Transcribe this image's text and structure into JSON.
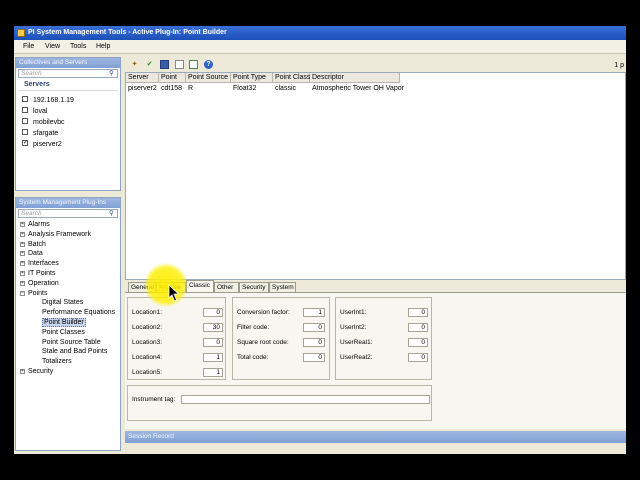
{
  "window": {
    "title": "PI System Management Tools - Active Plug-In: Point Builder"
  },
  "menu": [
    "File",
    "View",
    "Tools",
    "Help"
  ],
  "collectives": {
    "header": "Collectives and Servers",
    "search_placeholder": "Search",
    "servers_header": "Servers",
    "servers": [
      {
        "name": "192.168.1.19",
        "checked": false
      },
      {
        "name": "loval",
        "checked": false
      },
      {
        "name": "mobilevbc",
        "checked": false
      },
      {
        "name": "sfargate",
        "checked": false
      },
      {
        "name": "piserver2",
        "checked": true
      }
    ]
  },
  "plugins": {
    "header": "System Management Plug-Ins",
    "search_placeholder": "Search",
    "tree": [
      {
        "label": "Alarms",
        "type": "group"
      },
      {
        "label": "Analysis Framework",
        "type": "group"
      },
      {
        "label": "Batch",
        "type": "group"
      },
      {
        "label": "Data",
        "type": "group"
      },
      {
        "label": "Interfaces",
        "type": "group"
      },
      {
        "label": "IT Points",
        "type": "group"
      },
      {
        "label": "Operation",
        "type": "group"
      },
      {
        "label": "Points",
        "type": "open"
      },
      {
        "label": "Digital States",
        "type": "child"
      },
      {
        "label": "Performance Equations",
        "type": "child"
      },
      {
        "label": "Point Builder",
        "type": "child",
        "selected": true
      },
      {
        "label": "Point Classes",
        "type": "child"
      },
      {
        "label": "Point Source Table",
        "type": "child"
      },
      {
        "label": "Stale and Bad Points",
        "type": "child"
      },
      {
        "label": "Totalizers",
        "type": "child"
      },
      {
        "label": "Security",
        "type": "group"
      }
    ]
  },
  "toolbar": {
    "page_indicator": "1 p"
  },
  "grid": {
    "columns": [
      "Server",
      "Point",
      "Point Source",
      "Point Type",
      "Point Class",
      "Descriptor"
    ],
    "rows": [
      [
        "piserver2",
        "cdt158",
        "R",
        "Float32",
        "classic",
        "Atmospheric Tower OH Vapor"
      ]
    ]
  },
  "tabs": [
    "General",
    "Archive",
    "Classic",
    "Other",
    "Security",
    "System"
  ],
  "active_tab": "Classic",
  "classic": {
    "locations": [
      {
        "label": "Location1:",
        "value": "0"
      },
      {
        "label": "Location2:",
        "value": "30"
      },
      {
        "label": "Location3:",
        "value": "0"
      },
      {
        "label": "Location4:",
        "value": "1"
      },
      {
        "label": "Location5:",
        "value": "1"
      }
    ],
    "codes": [
      {
        "label": "Conversion factor:",
        "value": "1"
      },
      {
        "label": "Filter code:",
        "value": "0"
      },
      {
        "label": "Square root code:",
        "value": "0"
      },
      {
        "label": "Total code:",
        "value": "0"
      }
    ],
    "user": [
      {
        "label": "UserInt1:",
        "value": "0"
      },
      {
        "label": "UserInt2:",
        "value": "0"
      },
      {
        "label": "UserReal1:",
        "value": "0"
      },
      {
        "label": "UserReal2:",
        "value": "0"
      }
    ],
    "instrument_tag_label": "Instrument tag:",
    "instrument_tag_value": ""
  },
  "session": {
    "header": "Session Record"
  }
}
